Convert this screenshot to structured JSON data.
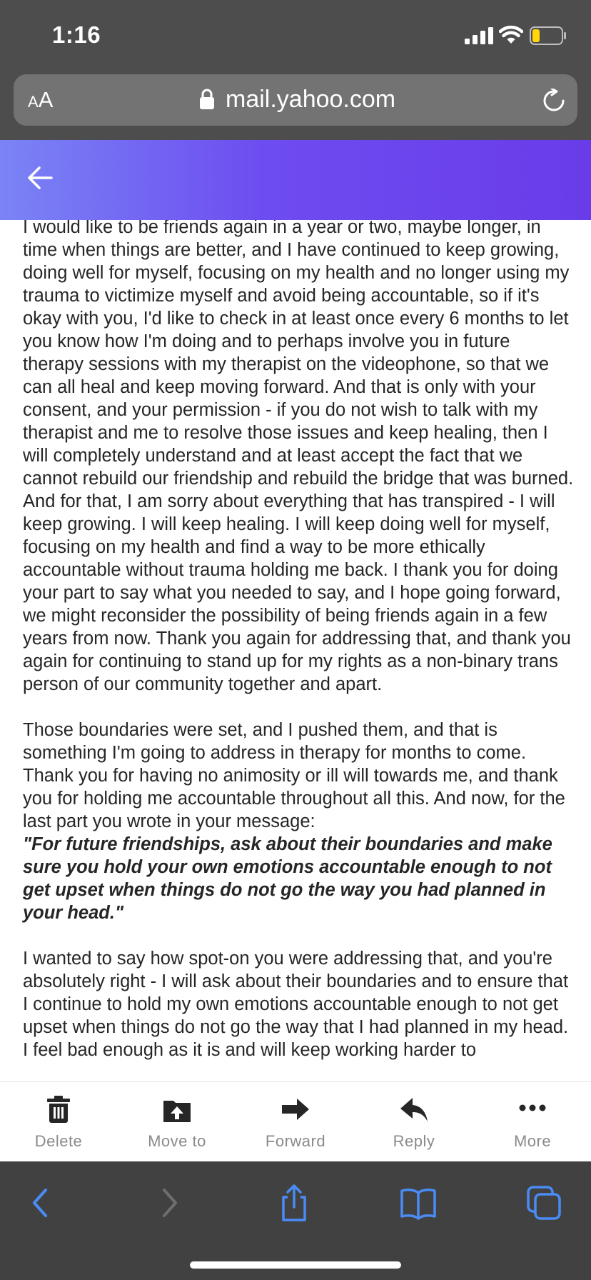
{
  "status_bar": {
    "time": "1:16"
  },
  "browser": {
    "text_size_label": "AA",
    "url": "mail.yahoo.com"
  },
  "message": {
    "paragraphs": [
      "I would like to be friends again in a year or two, maybe longer, in time when things are better, and I have continued to keep growing, doing well for myself, focusing on my health and no longer using my trauma to victimize myself and avoid being accountable, so if it's okay with you, I'd like to check in at least once every 6 months to let you know how I'm doing and to perhaps involve you in future therapy sessions with my therapist on the videophone, so that we can all heal and keep moving forward. And that is only with your consent, and your permission - if you do not wish to talk with my therapist and me to resolve those issues and keep healing, then I will completely understand and at least accept the fact that we cannot rebuild our friendship and rebuild the bridge that was burned. And for that, I am sorry about everything that has transpired - I will keep growing. I will keep healing. I will keep doing well for myself, focusing on my health and find a way to be more ethically accountable without trauma holding me back. I thank you for doing your part to say what you needed to say, and I hope going forward, we might reconsider the possibility of being friends again in a few years from now. Thank you again for addressing that, and thank you again for continuing to stand up for my rights as a non-binary trans person of our community together and apart.",
      "Those boundaries were set, and I pushed them, and that is something I'm going to address in therapy for months to come. Thank you for having no animosity or ill will towards me, and thank you for holding me accountable throughout all this. And now, for the last part you wrote in your message:",
      "I wanted to say how spot-on you were addressing that, and you're absolutely right - I will ask about their boundaries and to ensure that I continue to hold my own emotions accountable enough to not get upset when things do not go the way that I had planned in my head. I feel bad enough as it is and will keep working harder to"
    ],
    "quote": "\"For future friendships, ask about their boundaries and make sure you hold your own emotions accountable enough to not get upset when things do not go the way you had planned in your head.\""
  },
  "actions": [
    {
      "label": "Delete",
      "icon": "trash-icon"
    },
    {
      "label": "Move to",
      "icon": "move-to-folder-icon"
    },
    {
      "label": "Forward",
      "icon": "forward-arrow-icon"
    },
    {
      "label": "Reply",
      "icon": "reply-arrow-icon"
    },
    {
      "label": "More",
      "icon": "more-dots-icon"
    }
  ],
  "safari_toolbar": [
    "back-icon",
    "forward-icon",
    "share-icon",
    "bookmarks-icon",
    "tabs-icon"
  ],
  "colors": {
    "header_gradient_start": "#7a84f5",
    "header_gradient_end": "#6a3ce9",
    "safari_accent": "#4a8cf7",
    "battery_level": "#ffd60a"
  }
}
